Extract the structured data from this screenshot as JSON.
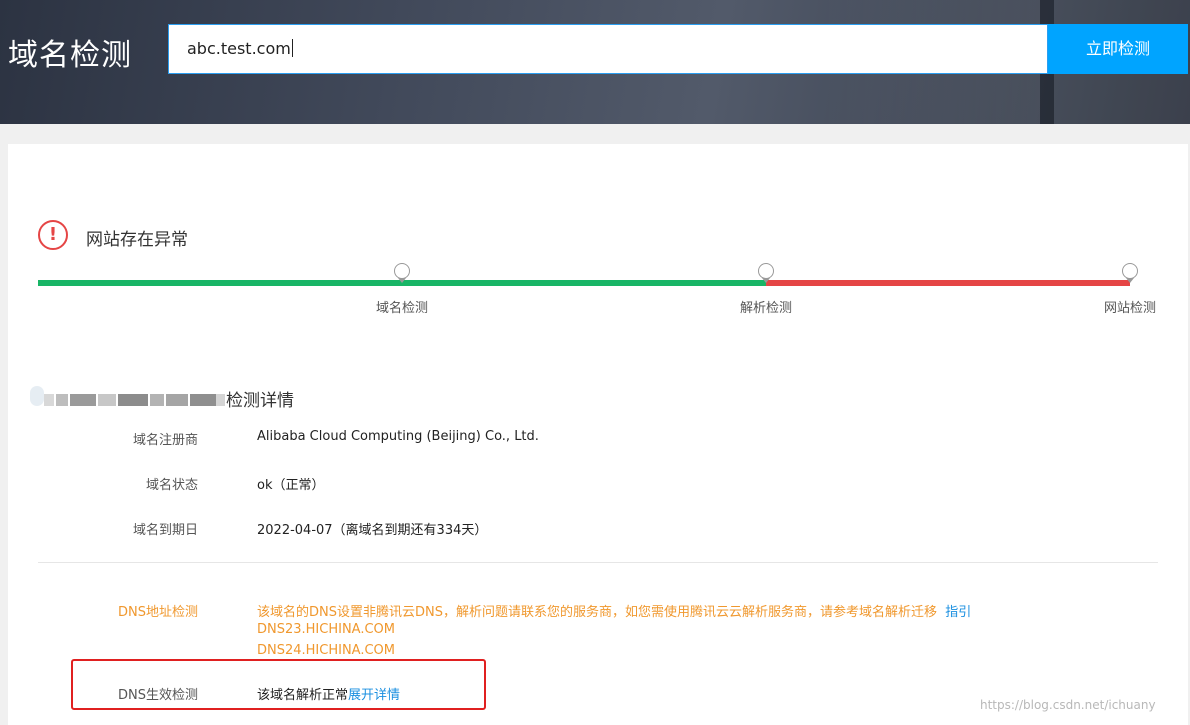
{
  "header": {
    "title": "域名检测",
    "search_value": "abc.test.com",
    "detect_label": "立即检测"
  },
  "status": {
    "icon": "exclamation-circle-icon",
    "text": "网站存在异常"
  },
  "progress": {
    "steps": [
      {
        "label": "域名检测",
        "state": "ok"
      },
      {
        "label": "解析检测",
        "state": "ok"
      },
      {
        "label": "网站检测",
        "state": "error"
      }
    ]
  },
  "detail": {
    "title": "检测详情",
    "rows": [
      {
        "label": "域名注册商",
        "value": "Alibaba Cloud Computing (Beijing) Co., Ltd."
      },
      {
        "label": "域名状态",
        "value": "ok（正常）"
      },
      {
        "label": "域名到期日",
        "value": "2022-04-07（离域名到期还有334天）"
      }
    ]
  },
  "dns": {
    "address_label": "DNS地址检测",
    "address_message": "该域名的DNS设置非腾讯云DNS，解析问题请联系您的服务商，如您需使用腾讯云云解析服务商，请参考域名解析迁移",
    "address_link": "指引",
    "servers": [
      "DNS23.HICHINA.COM",
      "DNS24.HICHINA.COM"
    ],
    "effect_label": "DNS生效检测",
    "effect_message": "该域名解析正常",
    "effect_link": "展开详情"
  },
  "watermark": "https://blog.csdn.net/ichuany",
  "colors": {
    "accent": "#00a4ff",
    "ok": "#18b566",
    "error": "#e54545",
    "warning": "#f0982e",
    "link": "#1a8fe0"
  }
}
